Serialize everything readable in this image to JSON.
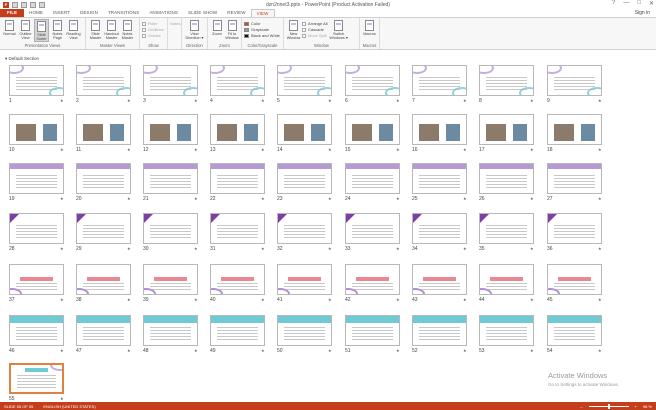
{
  "window": {
    "title": "dzn2nnet3.pptx - PowerPoint (Product Activation Failed)",
    "controls": [
      "?",
      "—",
      "□",
      "✕"
    ],
    "sign_in": "Sign in"
  },
  "tabs": [
    "FILE",
    "HOME",
    "INSERT",
    "DESIGN",
    "TRANSITIONS",
    "ANIMATIONS",
    "SLIDE SHOW",
    "REVIEW",
    "VIEW"
  ],
  "active_tab": "VIEW",
  "ribbon": {
    "presentation_views": {
      "label": "Presentation Views",
      "buttons": [
        "Normal",
        "Outline View",
        "Slide Sorter",
        "Notes Page",
        "Reading View"
      ]
    },
    "master_views": {
      "label": "Master Views",
      "buttons": [
        "Slide Master",
        "Handout Master",
        "Notes Master"
      ]
    },
    "show": {
      "label": "Show",
      "items": [
        "Ruler",
        "Gridlines",
        "Guides"
      ]
    },
    "notes_btn": "Notes",
    "direction": {
      "label": "Direction",
      "button": "View Direction ▾"
    },
    "zoom": {
      "label": "Zoom",
      "buttons": [
        "Zoom",
        "Fit to Window"
      ]
    },
    "color": {
      "label": "Color/Grayscale",
      "items": [
        "Color",
        "Grayscale",
        "Black and White"
      ]
    },
    "window": {
      "label": "Window",
      "new_window": "New Window",
      "items": [
        "Arrange All",
        "Cascade",
        "Move Split"
      ],
      "switch": "Switch Windows ▾"
    },
    "macros": {
      "label": "Macros",
      "button": "Macros"
    }
  },
  "section_name": "Default Section",
  "slides": [
    "1",
    "2",
    "3",
    "4",
    "5",
    "6",
    "7",
    "8",
    "9",
    "10",
    "11",
    "12",
    "13",
    "14",
    "15",
    "16",
    "17",
    "18",
    "19",
    "20",
    "21",
    "22",
    "23",
    "24",
    "25",
    "26",
    "27",
    "28",
    "29",
    "30",
    "31",
    "32",
    "33",
    "34",
    "35",
    "36",
    "37",
    "38",
    "39",
    "40",
    "41",
    "42",
    "43",
    "44",
    "45",
    "46",
    "47",
    "48",
    "49",
    "50",
    "51",
    "52",
    "53",
    "54",
    "55"
  ],
  "selected_slide": "55",
  "watermark": {
    "line1": "Activate Windows",
    "line2": "Go to Settings to activate Windows."
  },
  "status": {
    "slide_info": "SLIDE 55 OF 55",
    "language": "ENGLISH (UNITED STATES)",
    "zoom": "98 %",
    "zoom_fraction": 0.5
  }
}
